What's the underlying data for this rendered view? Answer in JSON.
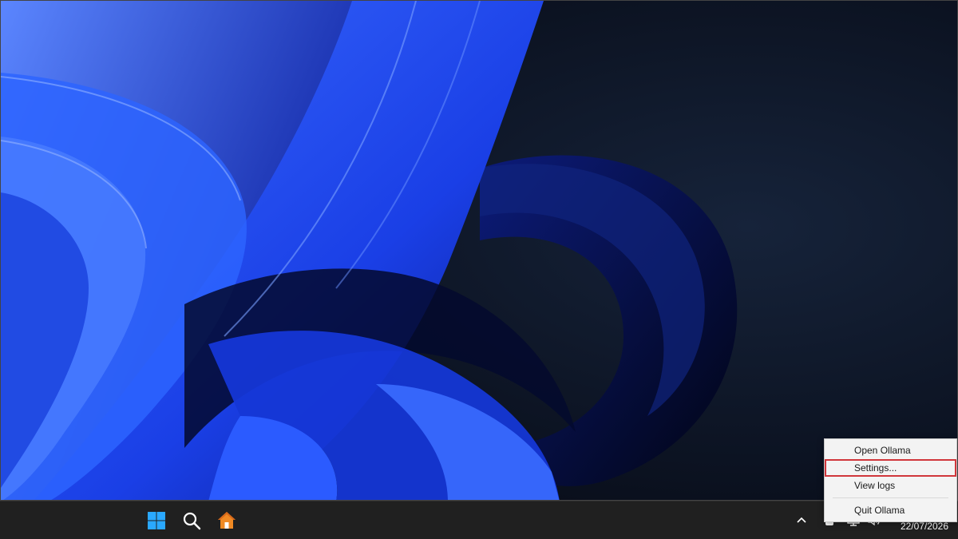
{
  "desktop": {
    "wallpaper": "windows-11-bloom-wallpaper",
    "colors": {
      "accent": "#1a4dff",
      "background": "#0a0f1c"
    }
  },
  "taskbar": {
    "start_icon": "windows-logo-icon",
    "search_icon": "search-icon",
    "home_icon": "home-icon",
    "tray": {
      "chevron_icon": "chevron-up-icon",
      "app_icon": "tray-app-icon",
      "network_icon": "network-icon",
      "volume_icon": "volume-icon"
    },
    "clock": {
      "date": "22/07/2026"
    }
  },
  "context_menu": {
    "items": [
      {
        "label": "Open Ollama"
      },
      {
        "label": "Settings..."
      },
      {
        "label": "View logs"
      },
      {
        "label": "Quit Ollama"
      }
    ],
    "highlight_color": "#d0363b"
  }
}
